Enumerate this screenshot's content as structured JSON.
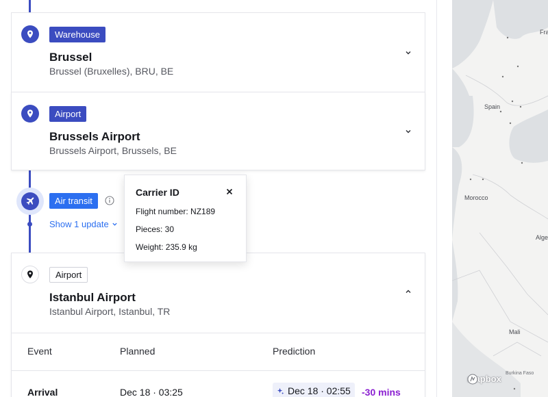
{
  "stops": [
    {
      "tag": "Warehouse",
      "title": "Brussel",
      "subtitle": "Brussel (Bruxelles), BRU, BE"
    },
    {
      "tag": "Airport",
      "title": "Brussels Airport",
      "subtitle": "Brussels Airport, Brussels, BE"
    },
    {
      "tag": "Airport",
      "title": "Istanbul Airport",
      "subtitle": "Istanbul Airport, Istanbul, TR"
    }
  ],
  "transit": {
    "tag": "Air transit",
    "show_updates": "Show 1 update",
    "icon": "plane-icon"
  },
  "popover": {
    "title": "Carrier ID",
    "lines": [
      "Flight number: NZ189",
      "Pieces: 30",
      "Weight: 235.9 kg"
    ]
  },
  "table": {
    "headers": [
      "Event",
      "Planned",
      "Prediction"
    ],
    "rows": [
      {
        "event": "Arrival",
        "planned": "Dec 18 · 03:25",
        "prediction": "Dec 18 · 02:55",
        "delta": "-30 mins"
      }
    ]
  },
  "map": {
    "labels": [
      "Spain",
      "Morocco",
      "Mali",
      "Alge",
      "Fra"
    ],
    "attribution": "mapbox",
    "burkina": "Burkina Faso"
  },
  "colors": {
    "primary": "#3b4cc0",
    "transit": "#2c6ff0",
    "delta": "#8a1fd1"
  }
}
